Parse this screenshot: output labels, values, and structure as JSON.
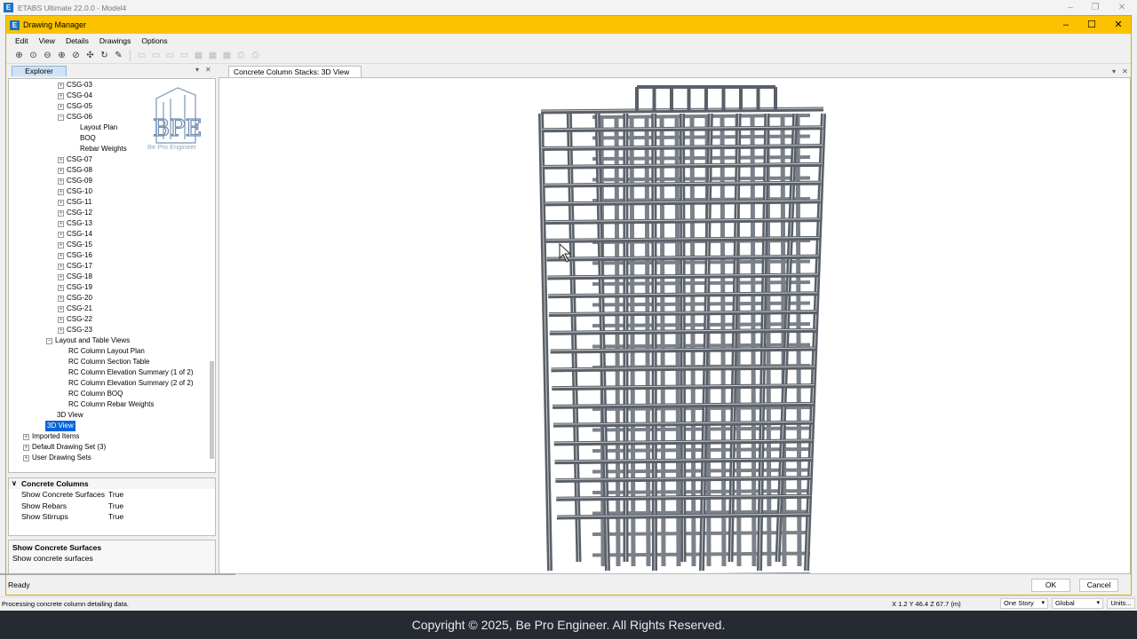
{
  "app": {
    "title": "ETABS Ultimate 22.0.0 - Model4",
    "logo_letter": "E"
  },
  "dialog": {
    "title": "Drawing Manager",
    "logo_letter": "E",
    "menu": [
      "Edit",
      "View",
      "Details",
      "Drawings",
      "Options"
    ],
    "toolbar_icons": [
      "zoom-window-icon",
      "zoom-rubber-icon",
      "zoom-out-icon",
      "zoom-in-icon",
      "zoom-fit-icon",
      "pan-icon",
      "rotate-icon",
      "edit-icon",
      "layout-1-icon",
      "layout-2-icon",
      "layout-3-icon",
      "layout-4-icon",
      "grid-1-icon",
      "grid-2-icon",
      "grid-3-icon",
      "print-icon",
      "print-preview-icon"
    ]
  },
  "explorer": {
    "tab_label": "Explorer",
    "logo_caption": "Be Pro Engineer",
    "logo_letters": "BPE",
    "items": [
      {
        "label": "CSG-03",
        "indent": 2,
        "expander": "+"
      },
      {
        "label": "CSG-04",
        "indent": 2,
        "expander": "+"
      },
      {
        "label": "CSG-05",
        "indent": 2,
        "expander": "+"
      },
      {
        "label": "CSG-06",
        "indent": 2,
        "expander": "-"
      },
      {
        "label": "Layout Plan",
        "indent": 3,
        "expander": ""
      },
      {
        "label": "BOQ",
        "indent": 3,
        "expander": ""
      },
      {
        "label": "Rebar Weights",
        "indent": 3,
        "expander": ""
      },
      {
        "label": "CSG-07",
        "indent": 2,
        "expander": "+"
      },
      {
        "label": "CSG-08",
        "indent": 2,
        "expander": "+"
      },
      {
        "label": "CSG-09",
        "indent": 2,
        "expander": "+"
      },
      {
        "label": "CSG-10",
        "indent": 2,
        "expander": "+"
      },
      {
        "label": "CSG-11",
        "indent": 2,
        "expander": "+"
      },
      {
        "label": "CSG-12",
        "indent": 2,
        "expander": "+"
      },
      {
        "label": "CSG-13",
        "indent": 2,
        "expander": "+"
      },
      {
        "label": "CSG-14",
        "indent": 2,
        "expander": "+"
      },
      {
        "label": "CSG-15",
        "indent": 2,
        "expander": "+"
      },
      {
        "label": "CSG-16",
        "indent": 2,
        "expander": "+"
      },
      {
        "label": "CSG-17",
        "indent": 2,
        "expander": "+"
      },
      {
        "label": "CSG-18",
        "indent": 2,
        "expander": "+"
      },
      {
        "label": "CSG-19",
        "indent": 2,
        "expander": "+"
      },
      {
        "label": "CSG-20",
        "indent": 2,
        "expander": "+"
      },
      {
        "label": "CSG-21",
        "indent": 2,
        "expander": "+"
      },
      {
        "label": "CSG-22",
        "indent": 2,
        "expander": "+"
      },
      {
        "label": "CSG-23",
        "indent": 2,
        "expander": "+"
      },
      {
        "label": "Layout and Table Views",
        "indent": 1,
        "expander": "-"
      },
      {
        "label": "RC Column Layout Plan",
        "indent": 2,
        "expander": ""
      },
      {
        "label": "RC Column Section Table",
        "indent": 2,
        "expander": ""
      },
      {
        "label": "RC Column Elevation Summary (1 of 2)",
        "indent": 2,
        "expander": ""
      },
      {
        "label": "RC Column Elevation Summary (2 of 2)",
        "indent": 2,
        "expander": ""
      },
      {
        "label": "RC Column BOQ",
        "indent": 2,
        "expander": ""
      },
      {
        "label": "RC Column Rebar Weights",
        "indent": 2,
        "expander": ""
      },
      {
        "label": "3D View",
        "indent": 1,
        "expander": ""
      },
      {
        "label": "3D View",
        "indent": 0,
        "expander": "",
        "selected": true
      },
      {
        "label": "Imported Items",
        "indent": -1,
        "expander": "+"
      },
      {
        "label": "Default Drawing Set (3)",
        "indent": -1,
        "expander": "+"
      },
      {
        "label": "User Drawing Sets",
        "indent": -1,
        "expander": "+"
      }
    ]
  },
  "properties": {
    "group": "Concrete Columns",
    "rows": [
      {
        "name": "Show Concrete Surfaces",
        "value": "True"
      },
      {
        "name": "Show Rebars",
        "value": "True"
      },
      {
        "name": "Show Stirrups",
        "value": "True"
      }
    ]
  },
  "description": {
    "title": "Show Concrete Surfaces",
    "text": "Show concrete surfaces"
  },
  "viewer": {
    "tab_label": "Concrete Column Stacks: 3D View"
  },
  "dialog_status": {
    "ready": "Ready",
    "ok_label": "OK",
    "cancel_label": "Cancel"
  },
  "app_status": {
    "message": "Processing concrete column detailing data.",
    "coords": "X 1.2  Y 46.4  Z 67.7 (m)",
    "story": "One Story",
    "system": "Global",
    "units": "Units..."
  },
  "footer": {
    "text": "Copyright © 2025, Be Pro Engineer. All Rights Reserved."
  },
  "colors": {
    "dialog_title": "#fcc200",
    "selection": "#0a64d6",
    "footer_bg": "#262b31",
    "model_steel": "#5a6068"
  }
}
